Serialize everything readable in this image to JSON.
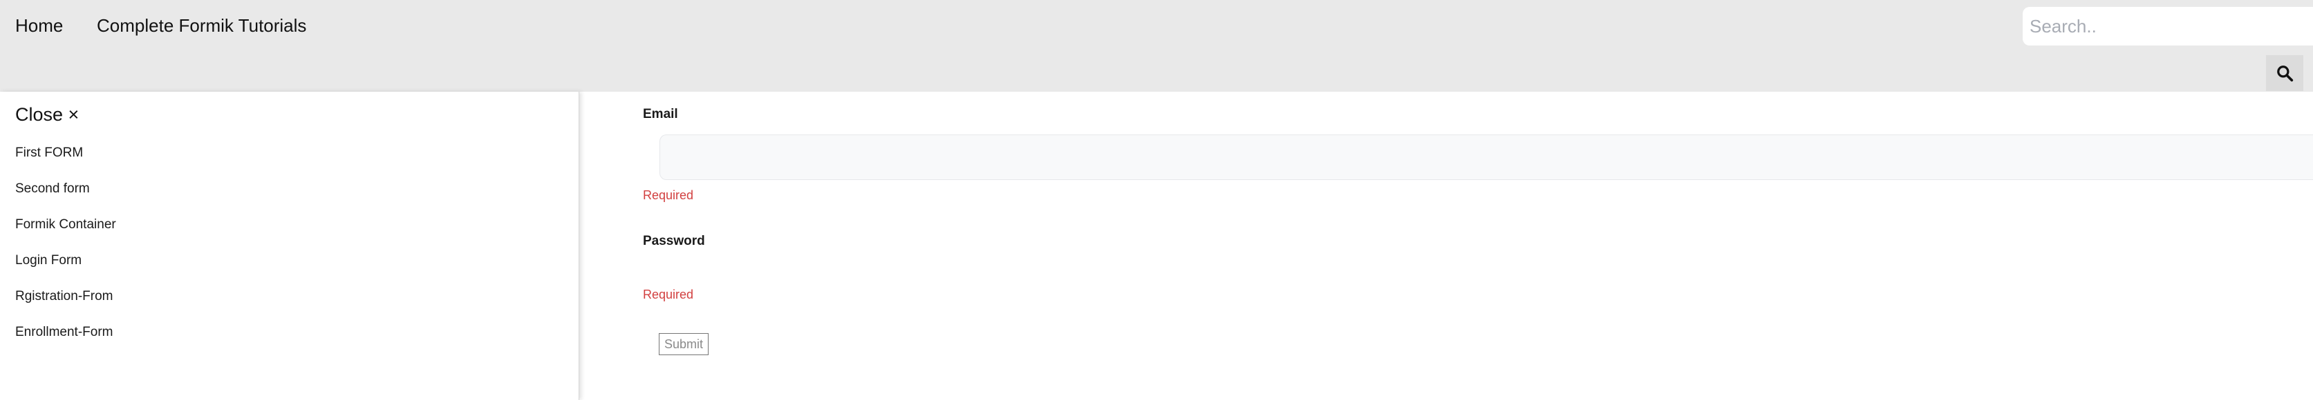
{
  "nav": {
    "home": "Home",
    "tutorials": "Complete Formik Tutorials"
  },
  "search": {
    "placeholder": "Search..",
    "icon": "search-icon"
  },
  "sidebar": {
    "close_label": "Close ×",
    "items": [
      {
        "label": "First FORM"
      },
      {
        "label": "Second form"
      },
      {
        "label": "Formik Container"
      },
      {
        "label": "Login Form"
      },
      {
        "label": "Rgistration-From"
      },
      {
        "label": "Enrollment-Form"
      }
    ]
  },
  "form": {
    "email_label": "Email",
    "email_value": "",
    "email_error": "Required",
    "password_label": "Password",
    "password_error": "Required",
    "submit_label": "Submit"
  },
  "colors": {
    "topbar_bg": "#e9e9e9",
    "error": "#d24040"
  }
}
